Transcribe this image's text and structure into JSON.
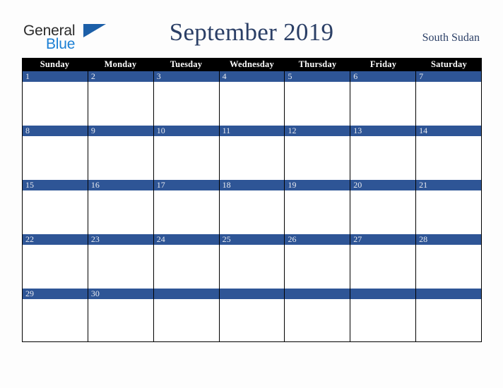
{
  "brand": {
    "name_part1": "General",
    "name_part2": "Blue",
    "triangle_icon": "blue-triangle-icon",
    "color_dark": "#2b2b2b",
    "color_blue": "#1b7fd4",
    "color_triangle": "#1c5fa8"
  },
  "header": {
    "title": "September 2019",
    "country": "South Sudan",
    "title_color": "#2b3f66"
  },
  "calendar": {
    "accent_color": "#2e5596",
    "header_bg": "#000000",
    "header_text_color": "#ffffff",
    "day_names": [
      "Sunday",
      "Monday",
      "Tuesday",
      "Wednesday",
      "Thursday",
      "Friday",
      "Saturday"
    ],
    "weeks": [
      [
        {
          "day": "1"
        },
        {
          "day": "2"
        },
        {
          "day": "3"
        },
        {
          "day": "4"
        },
        {
          "day": "5"
        },
        {
          "day": "6"
        },
        {
          "day": "7"
        }
      ],
      [
        {
          "day": "8"
        },
        {
          "day": "9"
        },
        {
          "day": "10"
        },
        {
          "day": "11"
        },
        {
          "day": "12"
        },
        {
          "day": "13"
        },
        {
          "day": "14"
        }
      ],
      [
        {
          "day": "15"
        },
        {
          "day": "16"
        },
        {
          "day": "17"
        },
        {
          "day": "18"
        },
        {
          "day": "19"
        },
        {
          "day": "20"
        },
        {
          "day": "21"
        }
      ],
      [
        {
          "day": "22"
        },
        {
          "day": "23"
        },
        {
          "day": "24"
        },
        {
          "day": "25"
        },
        {
          "day": "26"
        },
        {
          "day": "27"
        },
        {
          "day": "28"
        }
      ],
      [
        {
          "day": "29"
        },
        {
          "day": "30"
        },
        {
          "day": ""
        },
        {
          "day": ""
        },
        {
          "day": ""
        },
        {
          "day": ""
        },
        {
          "day": ""
        }
      ]
    ]
  }
}
